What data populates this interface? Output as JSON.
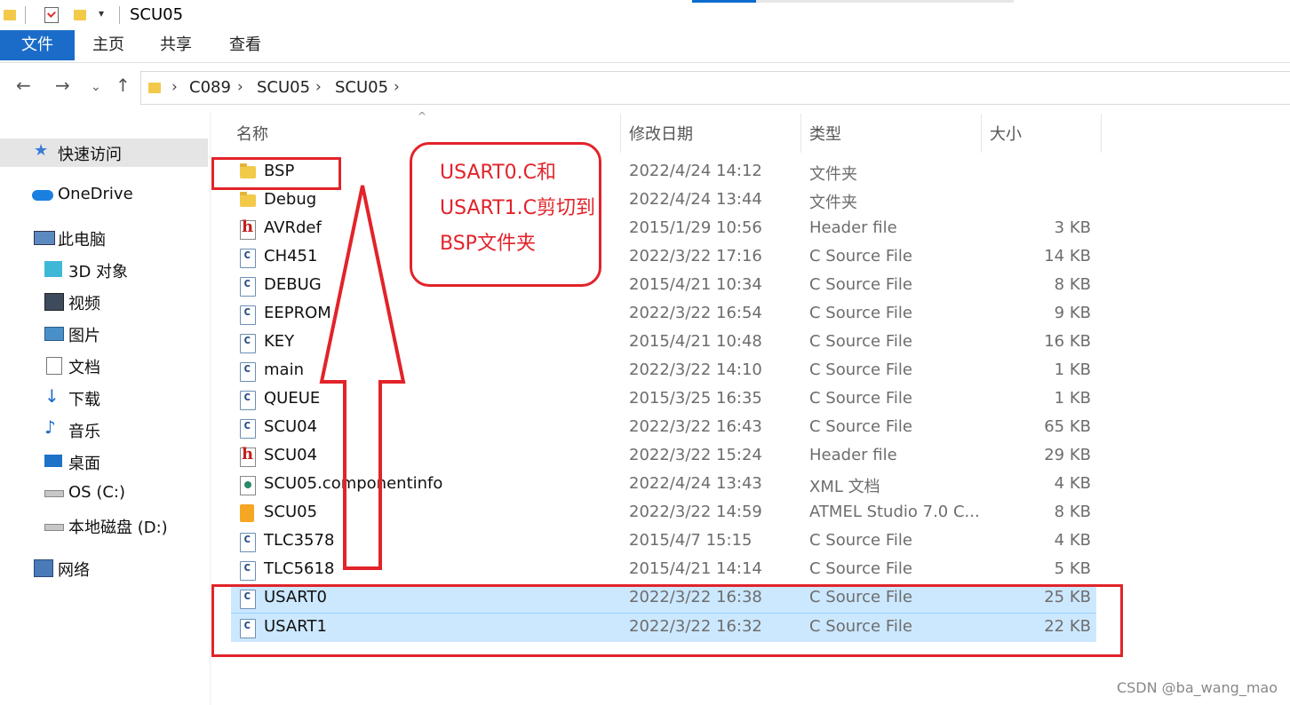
{
  "window": {
    "title": "SCU05"
  },
  "ribbon": {
    "tabs": [
      "文件",
      "主页",
      "共享",
      "查看"
    ]
  },
  "address": {
    "crumbs": [
      "C089",
      "SCU05",
      "SCU05"
    ],
    "separator": "›",
    "back": "←",
    "forward": "→",
    "recent": "⌄",
    "up": "↑"
  },
  "sidebar": {
    "items": [
      {
        "label": "快速访问",
        "icon": "star-icon",
        "selected": true
      },
      {
        "label": "OneDrive",
        "icon": "cloud-icon"
      },
      {
        "label": "此电脑",
        "icon": "pc-icon"
      },
      {
        "label": "3D 对象",
        "icon": "cube-icon"
      },
      {
        "label": "视频",
        "icon": "video-icon"
      },
      {
        "label": "图片",
        "icon": "picture-icon"
      },
      {
        "label": "文档",
        "icon": "document-icon"
      },
      {
        "label": "下载",
        "icon": "download-icon"
      },
      {
        "label": "音乐",
        "icon": "music-icon"
      },
      {
        "label": "桌面",
        "icon": "desktop-icon"
      },
      {
        "label": "OS (C:)",
        "icon": "drive-os-icon"
      },
      {
        "label": "本地磁盘 (D:)",
        "icon": "drive-icon"
      },
      {
        "label": "网络",
        "icon": "network-icon"
      }
    ]
  },
  "columns": {
    "name": "名称",
    "date": "修改日期",
    "type": "类型",
    "size": "大小"
  },
  "files": [
    {
      "name": "BSP",
      "date": "2022/4/24 14:12",
      "type": "文件夹",
      "size": "",
      "icon": "folder"
    },
    {
      "name": "Debug",
      "date": "2022/4/24 13:44",
      "type": "文件夹",
      "size": "",
      "icon": "folder"
    },
    {
      "name": "AVRdef",
      "date": "2015/1/29 10:56",
      "type": "Header file",
      "size": "3 KB",
      "icon": "h"
    },
    {
      "name": "CH451",
      "date": "2022/3/22 17:16",
      "type": "C Source File",
      "size": "14 KB",
      "icon": "c"
    },
    {
      "name": "DEBUG",
      "date": "2015/4/21 10:34",
      "type": "C Source File",
      "size": "8 KB",
      "icon": "c"
    },
    {
      "name": "EEPROM",
      "date": "2022/3/22 16:54",
      "type": "C Source File",
      "size": "9 KB",
      "icon": "c"
    },
    {
      "name": "KEY",
      "date": "2015/4/21 10:48",
      "type": "C Source File",
      "size": "16 KB",
      "icon": "c"
    },
    {
      "name": "main",
      "date": "2022/3/22 14:10",
      "type": "C Source File",
      "size": "1 KB",
      "icon": "c"
    },
    {
      "name": "QUEUE",
      "date": "2015/3/25 16:35",
      "type": "C Source File",
      "size": "1 KB",
      "icon": "c"
    },
    {
      "name": "SCU04",
      "date": "2022/3/22 16:43",
      "type": "C Source File",
      "size": "65 KB",
      "icon": "c"
    },
    {
      "name": "SCU04",
      "date": "2022/3/22 15:24",
      "type": "Header file",
      "size": "29 KB",
      "icon": "h"
    },
    {
      "name": "SCU05.componentinfo",
      "date": "2022/4/24 13:43",
      "type": "XML 文档",
      "size": "4 KB",
      "icon": "xml"
    },
    {
      "name": "SCU05",
      "date": "2022/3/22 14:59",
      "type": "ATMEL Studio 7.0 C...",
      "size": "8 KB",
      "icon": "atsln"
    },
    {
      "name": "TLC3578",
      "date": "2015/4/7 15:15",
      "type": "C Source File",
      "size": "4 KB",
      "icon": "c"
    },
    {
      "name": "TLC5618",
      "date": "2015/4/21 14:14",
      "type": "C Source File",
      "size": "5 KB",
      "icon": "c"
    },
    {
      "name": "USART0",
      "date": "2022/3/22 16:38",
      "type": "C Source File",
      "size": "25 KB",
      "icon": "c",
      "selected": true
    },
    {
      "name": "USART1",
      "date": "2022/3/22 16:32",
      "type": "C Source File",
      "size": "22 KB",
      "icon": "c",
      "selected": true
    }
  ],
  "annotation": {
    "lines": [
      "USART0.C和",
      "USART1.C剪切到",
      "BSP文件夹"
    ],
    "color": "#e2232a"
  },
  "watermark": "CSDN @ba_wang_mao",
  "colors": {
    "selection": "#cce8ff",
    "accent": "#1a6cc8"
  }
}
